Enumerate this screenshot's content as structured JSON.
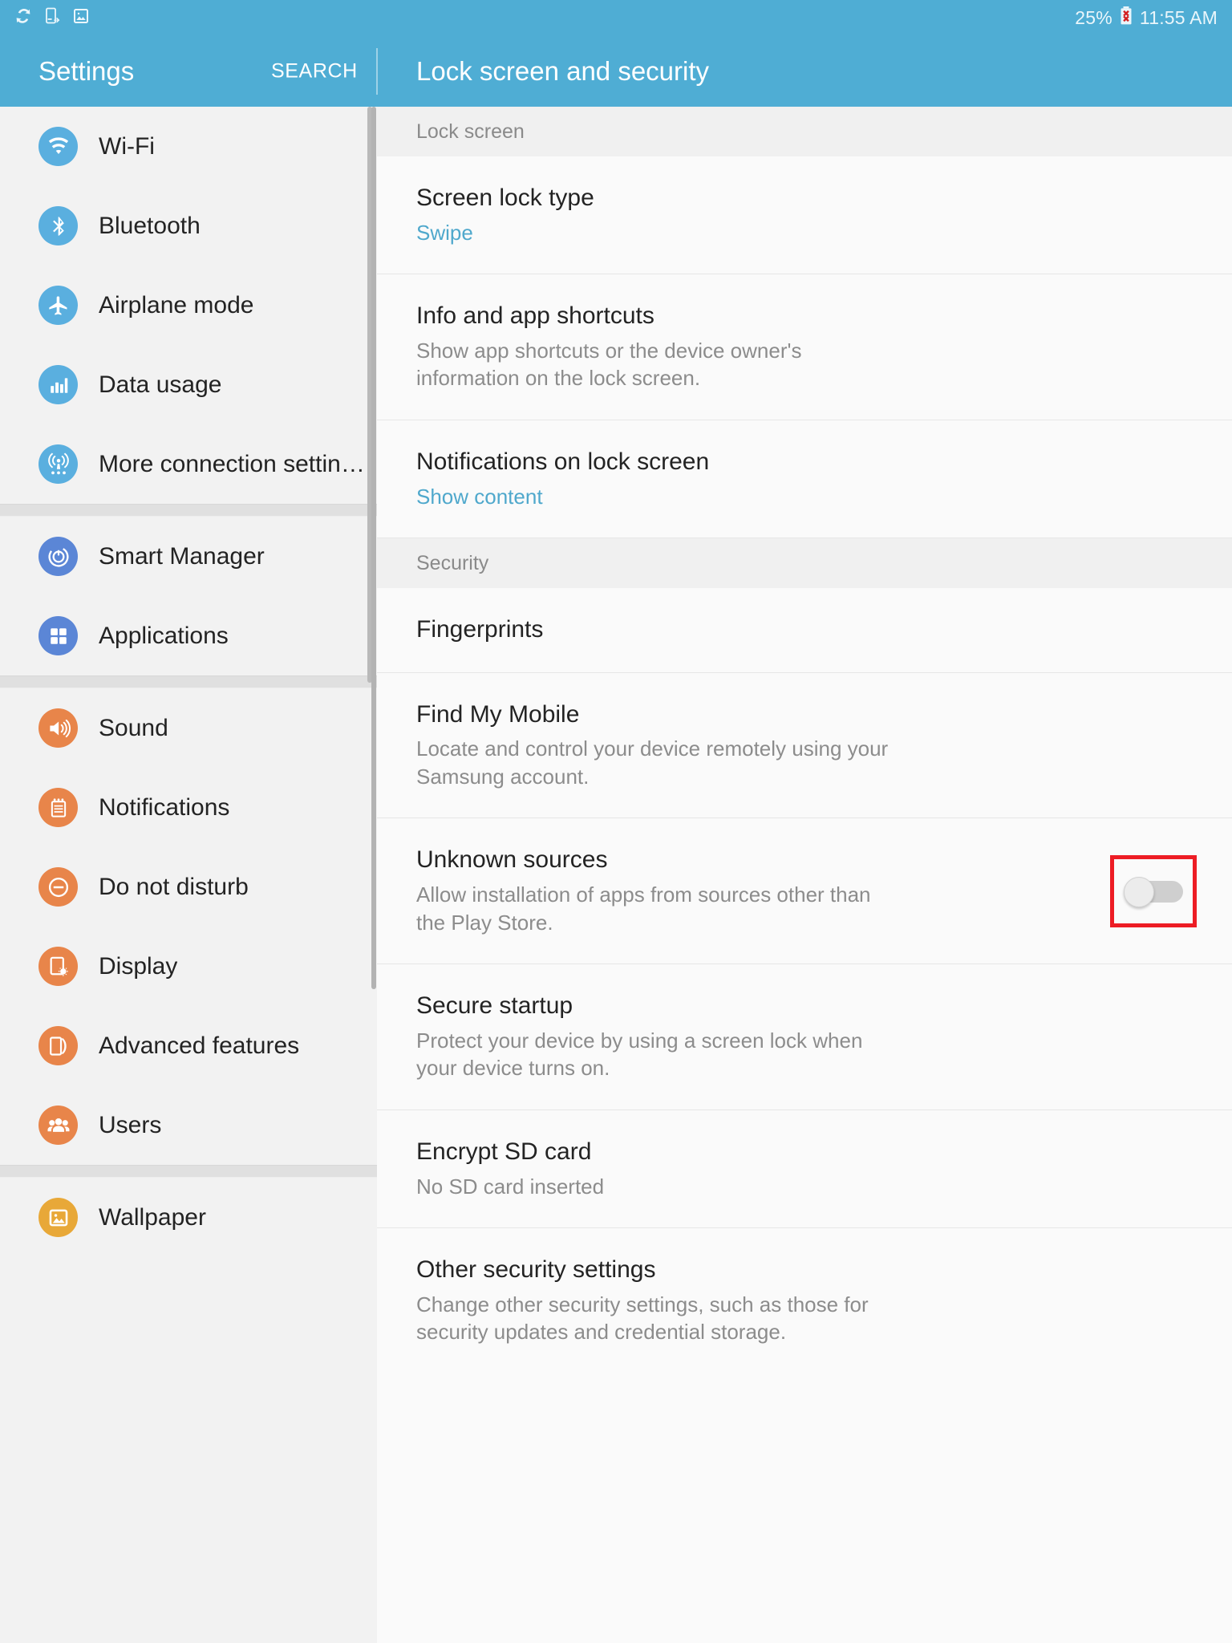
{
  "status_bar": {
    "icons": [
      "samsung-sync-icon",
      "device-transfer-icon",
      "screenshot-image-icon"
    ],
    "battery_percent": "25%",
    "battery_icon": "battery-error-icon",
    "time": "11:55 AM"
  },
  "app_bar": {
    "title": "Settings",
    "search_label": "SEARCH",
    "page_title": "Lock screen and security",
    "accent_color": "#4fadd4"
  },
  "sidebar": {
    "groups": [
      {
        "items": [
          {
            "label": "Wi-Fi",
            "icon": "wifi-icon",
            "color": "#5aafdf"
          },
          {
            "label": "Bluetooth",
            "icon": "bluetooth-icon",
            "color": "#5aafdf"
          },
          {
            "label": "Airplane mode",
            "icon": "airplane-icon",
            "color": "#5aafdf"
          },
          {
            "label": "Data usage",
            "icon": "bar-chart-icon",
            "color": "#5aafdf"
          },
          {
            "label": "More connection settin…",
            "icon": "broadcast-tower-icon",
            "color": "#5aafdf"
          }
        ]
      },
      {
        "items": [
          {
            "label": "Smart Manager",
            "icon": "smart-manager-icon",
            "color": "#5b86d6"
          },
          {
            "label": "Applications",
            "icon": "grid-apps-icon",
            "color": "#5b86d6"
          }
        ]
      },
      {
        "items": [
          {
            "label": "Sound",
            "icon": "speaker-icon",
            "color": "#e8854a"
          },
          {
            "label": "Notifications",
            "icon": "notification-card-icon",
            "color": "#e8854a"
          },
          {
            "label": "Do not disturb",
            "icon": "do-not-disturb-icon",
            "color": "#e8854a"
          },
          {
            "label": "Display",
            "icon": "display-brightness-icon",
            "color": "#e8854a"
          },
          {
            "label": "Advanced features",
            "icon": "advanced-features-icon",
            "color": "#e8854a"
          },
          {
            "label": "Users",
            "icon": "users-icon",
            "color": "#e8854a"
          }
        ]
      },
      {
        "items": [
          {
            "label": "Wallpaper",
            "icon": "wallpaper-image-icon",
            "color": "#e8a838"
          }
        ]
      }
    ]
  },
  "content": {
    "sections": [
      {
        "header": "Lock screen",
        "rows": [
          {
            "title": "Screen lock type",
            "sub": "Swipe",
            "sub_is_link": true,
            "toggle": null
          },
          {
            "title": "Info and app shortcuts",
            "sub": "Show app shortcuts or the device owner's information on the lock screen.",
            "sub_is_link": false,
            "toggle": null
          },
          {
            "title": "Notifications on lock screen",
            "sub": "Show content",
            "sub_is_link": true,
            "toggle": null
          }
        ]
      },
      {
        "header": "Security",
        "rows": [
          {
            "title": "Fingerprints",
            "sub": "",
            "sub_is_link": false,
            "toggle": null
          },
          {
            "title": "Find My Mobile",
            "sub": "Locate and control your device remotely using your Samsung account.",
            "sub_is_link": false,
            "toggle": null
          },
          {
            "title": "Unknown sources",
            "sub": "Allow installation of apps from sources other than the Play Store.",
            "sub_is_link": false,
            "toggle": {
              "state": "off",
              "highlighted": true,
              "highlight_color": "#ed1c24"
            }
          },
          {
            "title": "Secure startup",
            "sub": "Protect your device by using a screen lock when your device turns on.",
            "sub_is_link": false,
            "toggle": null
          },
          {
            "title": "Encrypt SD card",
            "sub": "No SD card inserted",
            "sub_is_link": false,
            "toggle": null
          },
          {
            "title": "Other security settings",
            "sub": "Change other security settings, such as those for security updates and credential storage.",
            "sub_is_link": false,
            "toggle": null
          }
        ]
      }
    ]
  }
}
